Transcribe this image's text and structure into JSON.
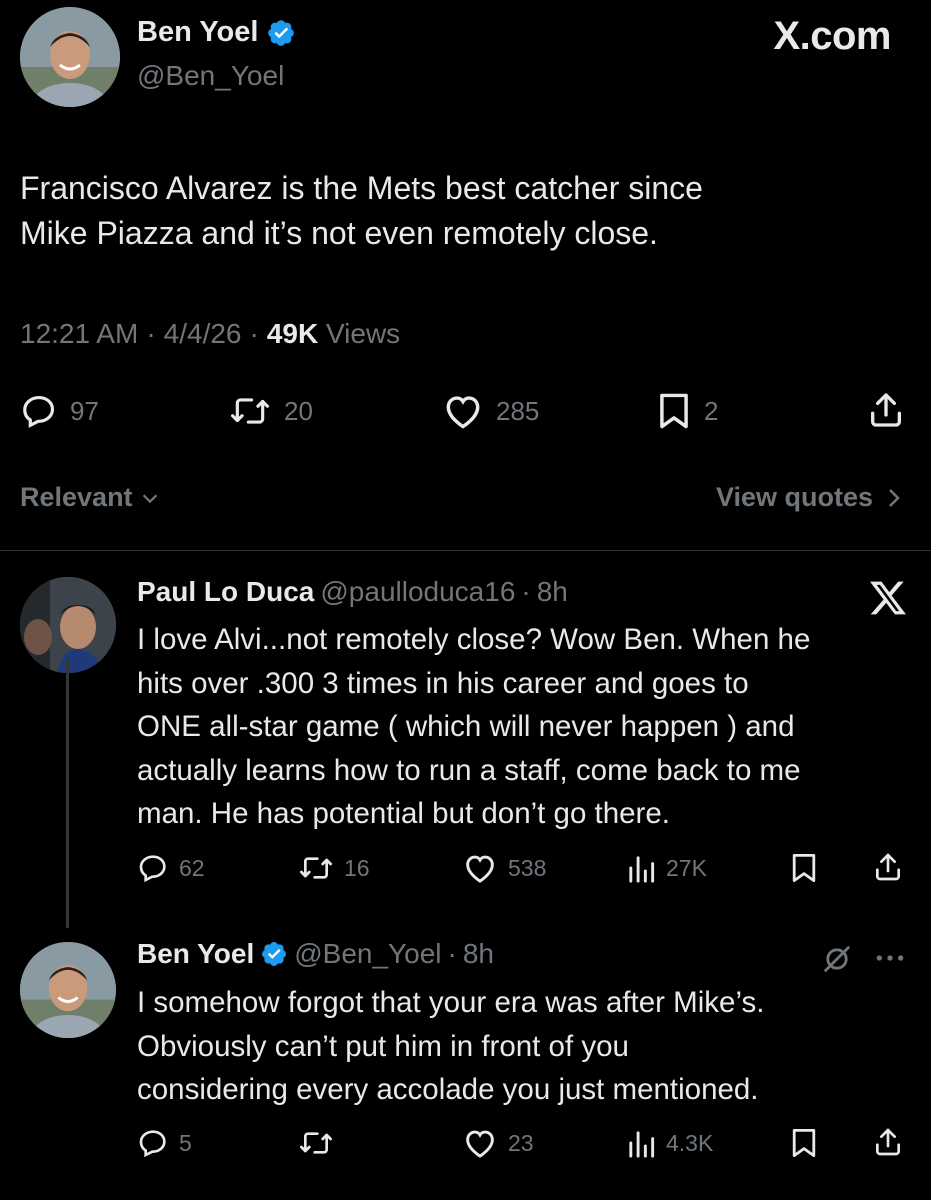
{
  "brand": {
    "watermark": "X.com"
  },
  "main_tweet": {
    "author_name": "Ben Yoel",
    "author_handle": "@Ben_Yoel",
    "text_line1": "Francisco Alvarez is the Mets best catcher since",
    "text_line2": "Mike Piazza and it’s not even remotely close.",
    "time": "12:21 AM",
    "date": "4/4/26",
    "views_count": "49K",
    "views_label": "Views",
    "replies": "97",
    "reposts": "20",
    "likes": "285",
    "bookmarks": "2"
  },
  "sort": {
    "label": "Relevant",
    "view_quotes": "View quotes"
  },
  "replies": [
    {
      "author_name": "Paul Lo Duca",
      "author_handle": "@paulloduca16",
      "age": "8h",
      "lines": [
        "I love Alvi...not remotely close? Wow Ben. When he",
        "hits over .300 3 times in his career and goes to",
        "ONE all-star game ( which will never happen ) and",
        "actually learns how to run a staff, come back to me",
        "man. He has potential but don’t go there."
      ],
      "replies": "62",
      "reposts": "16",
      "likes": "538",
      "views": "27K"
    },
    {
      "author_name": "Ben Yoel",
      "author_handle": "@Ben_Yoel",
      "age": "8h",
      "lines": [
        "I somehow forgot that your era was after Mike’s.",
        "Obviously can’t put him in front of you",
        "considering every accolade you just mentioned."
      ],
      "replies": "5",
      "reposts": "",
      "likes": "23",
      "views": "4.3K"
    }
  ],
  "icons": [
    "verified-badge-icon",
    "reply-icon",
    "repost-icon",
    "like-icon",
    "bookmark-icon",
    "share-icon",
    "views-icon",
    "chevron-down-icon",
    "chevron-right-icon",
    "x-logo-icon",
    "muted-icon",
    "more-icon"
  ],
  "colors": {
    "background": "#000000",
    "text": "#e7e9ea",
    "muted": "#71767b",
    "verified": "#1d9bf0",
    "divider": "#2f3336"
  }
}
